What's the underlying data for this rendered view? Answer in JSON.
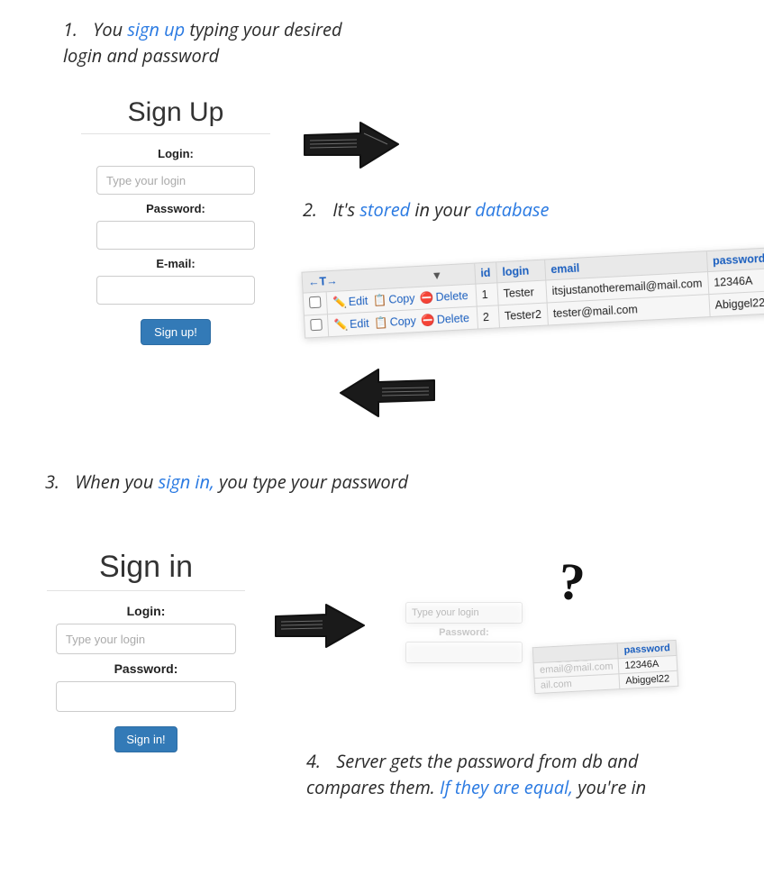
{
  "steps": {
    "s1_num": "1.",
    "s1_a": "You ",
    "s1_kw": "sign up",
    "s1_b": " typing your desired login and password",
    "s2_num": "2.",
    "s2_a": "It's ",
    "s2_kw1": "stored",
    "s2_b": " in your ",
    "s2_kw2": "database",
    "s3_num": "3.",
    "s3_a": "When you ",
    "s3_kw": "sign in,",
    "s3_b": " you type your password",
    "s4_num": "4.",
    "s4_a": "Server gets the password from db and compares them. ",
    "s4_kw": "If they are equal,",
    "s4_b": " you're in"
  },
  "signup": {
    "title": "Sign Up",
    "login_label": "Login:",
    "login_placeholder": "Type your login",
    "password_label": "Password:",
    "email_label": "E-mail:",
    "button": "Sign up!"
  },
  "signin": {
    "title": "Sign in",
    "login_label": "Login:",
    "login_placeholder": "Type your login",
    "password_label": "Password:",
    "button": "Sign in!"
  },
  "db": {
    "corner": "←T→",
    "dropdown": "▼",
    "headers": {
      "id": "id",
      "login": "login",
      "email": "email",
      "password": "password"
    },
    "actions": {
      "edit": "Edit",
      "copy": "Copy",
      "delete": "Delete"
    },
    "rows": [
      {
        "id": "1",
        "login": "Tester",
        "email": "itsjustanotheremail@mail.com",
        "password": "12346A"
      },
      {
        "id": "2",
        "login": "Tester2",
        "email": "tester@mail.com",
        "password": "Abiggel22"
      }
    ]
  },
  "compare": {
    "login_placeholder": "Type your login",
    "password_label": "Password:",
    "pw_header": "password",
    "email_frag1": "email@mail.com",
    "email_frag2": "ail.com",
    "pw1": "12346A",
    "pw2": "Abiggel22",
    "question": "?"
  },
  "icons": {
    "edit": "✏️",
    "copy": "📋",
    "delete": "⛔"
  }
}
